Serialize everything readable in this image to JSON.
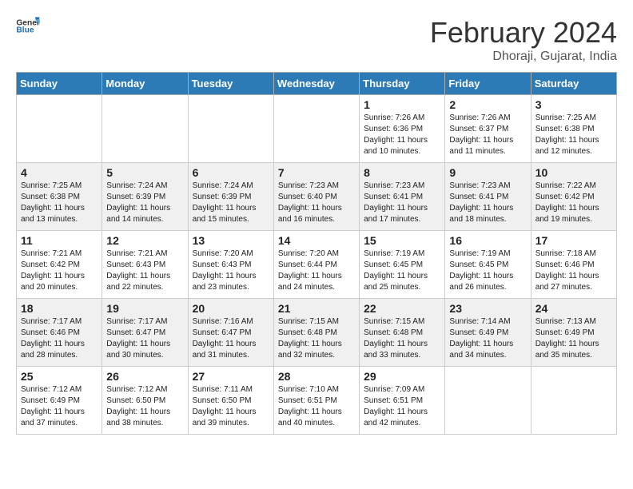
{
  "header": {
    "logo_general": "General",
    "logo_blue": "Blue",
    "title": "February 2024",
    "subtitle": "Dhoraji, Gujarat, India"
  },
  "weekdays": [
    "Sunday",
    "Monday",
    "Tuesday",
    "Wednesday",
    "Thursday",
    "Friday",
    "Saturday"
  ],
  "weeks": [
    [
      {
        "day": "",
        "info": ""
      },
      {
        "day": "",
        "info": ""
      },
      {
        "day": "",
        "info": ""
      },
      {
        "day": "",
        "info": ""
      },
      {
        "day": "1",
        "info": "Sunrise: 7:26 AM\nSunset: 6:36 PM\nDaylight: 11 hours\nand 10 minutes."
      },
      {
        "day": "2",
        "info": "Sunrise: 7:26 AM\nSunset: 6:37 PM\nDaylight: 11 hours\nand 11 minutes."
      },
      {
        "day": "3",
        "info": "Sunrise: 7:25 AM\nSunset: 6:38 PM\nDaylight: 11 hours\nand 12 minutes."
      }
    ],
    [
      {
        "day": "4",
        "info": "Sunrise: 7:25 AM\nSunset: 6:38 PM\nDaylight: 11 hours\nand 13 minutes."
      },
      {
        "day": "5",
        "info": "Sunrise: 7:24 AM\nSunset: 6:39 PM\nDaylight: 11 hours\nand 14 minutes."
      },
      {
        "day": "6",
        "info": "Sunrise: 7:24 AM\nSunset: 6:39 PM\nDaylight: 11 hours\nand 15 minutes."
      },
      {
        "day": "7",
        "info": "Sunrise: 7:23 AM\nSunset: 6:40 PM\nDaylight: 11 hours\nand 16 minutes."
      },
      {
        "day": "8",
        "info": "Sunrise: 7:23 AM\nSunset: 6:41 PM\nDaylight: 11 hours\nand 17 minutes."
      },
      {
        "day": "9",
        "info": "Sunrise: 7:23 AM\nSunset: 6:41 PM\nDaylight: 11 hours\nand 18 minutes."
      },
      {
        "day": "10",
        "info": "Sunrise: 7:22 AM\nSunset: 6:42 PM\nDaylight: 11 hours\nand 19 minutes."
      }
    ],
    [
      {
        "day": "11",
        "info": "Sunrise: 7:21 AM\nSunset: 6:42 PM\nDaylight: 11 hours\nand 20 minutes."
      },
      {
        "day": "12",
        "info": "Sunrise: 7:21 AM\nSunset: 6:43 PM\nDaylight: 11 hours\nand 22 minutes."
      },
      {
        "day": "13",
        "info": "Sunrise: 7:20 AM\nSunset: 6:43 PM\nDaylight: 11 hours\nand 23 minutes."
      },
      {
        "day": "14",
        "info": "Sunrise: 7:20 AM\nSunset: 6:44 PM\nDaylight: 11 hours\nand 24 minutes."
      },
      {
        "day": "15",
        "info": "Sunrise: 7:19 AM\nSunset: 6:45 PM\nDaylight: 11 hours\nand 25 minutes."
      },
      {
        "day": "16",
        "info": "Sunrise: 7:19 AM\nSunset: 6:45 PM\nDaylight: 11 hours\nand 26 minutes."
      },
      {
        "day": "17",
        "info": "Sunrise: 7:18 AM\nSunset: 6:46 PM\nDaylight: 11 hours\nand 27 minutes."
      }
    ],
    [
      {
        "day": "18",
        "info": "Sunrise: 7:17 AM\nSunset: 6:46 PM\nDaylight: 11 hours\nand 28 minutes."
      },
      {
        "day": "19",
        "info": "Sunrise: 7:17 AM\nSunset: 6:47 PM\nDaylight: 11 hours\nand 30 minutes."
      },
      {
        "day": "20",
        "info": "Sunrise: 7:16 AM\nSunset: 6:47 PM\nDaylight: 11 hours\nand 31 minutes."
      },
      {
        "day": "21",
        "info": "Sunrise: 7:15 AM\nSunset: 6:48 PM\nDaylight: 11 hours\nand 32 minutes."
      },
      {
        "day": "22",
        "info": "Sunrise: 7:15 AM\nSunset: 6:48 PM\nDaylight: 11 hours\nand 33 minutes."
      },
      {
        "day": "23",
        "info": "Sunrise: 7:14 AM\nSunset: 6:49 PM\nDaylight: 11 hours\nand 34 minutes."
      },
      {
        "day": "24",
        "info": "Sunrise: 7:13 AM\nSunset: 6:49 PM\nDaylight: 11 hours\nand 35 minutes."
      }
    ],
    [
      {
        "day": "25",
        "info": "Sunrise: 7:12 AM\nSunset: 6:49 PM\nDaylight: 11 hours\nand 37 minutes."
      },
      {
        "day": "26",
        "info": "Sunrise: 7:12 AM\nSunset: 6:50 PM\nDaylight: 11 hours\nand 38 minutes."
      },
      {
        "day": "27",
        "info": "Sunrise: 7:11 AM\nSunset: 6:50 PM\nDaylight: 11 hours\nand 39 minutes."
      },
      {
        "day": "28",
        "info": "Sunrise: 7:10 AM\nSunset: 6:51 PM\nDaylight: 11 hours\nand 40 minutes."
      },
      {
        "day": "29",
        "info": "Sunrise: 7:09 AM\nSunset: 6:51 PM\nDaylight: 11 hours\nand 42 minutes."
      },
      {
        "day": "",
        "info": ""
      },
      {
        "day": "",
        "info": ""
      }
    ]
  ]
}
